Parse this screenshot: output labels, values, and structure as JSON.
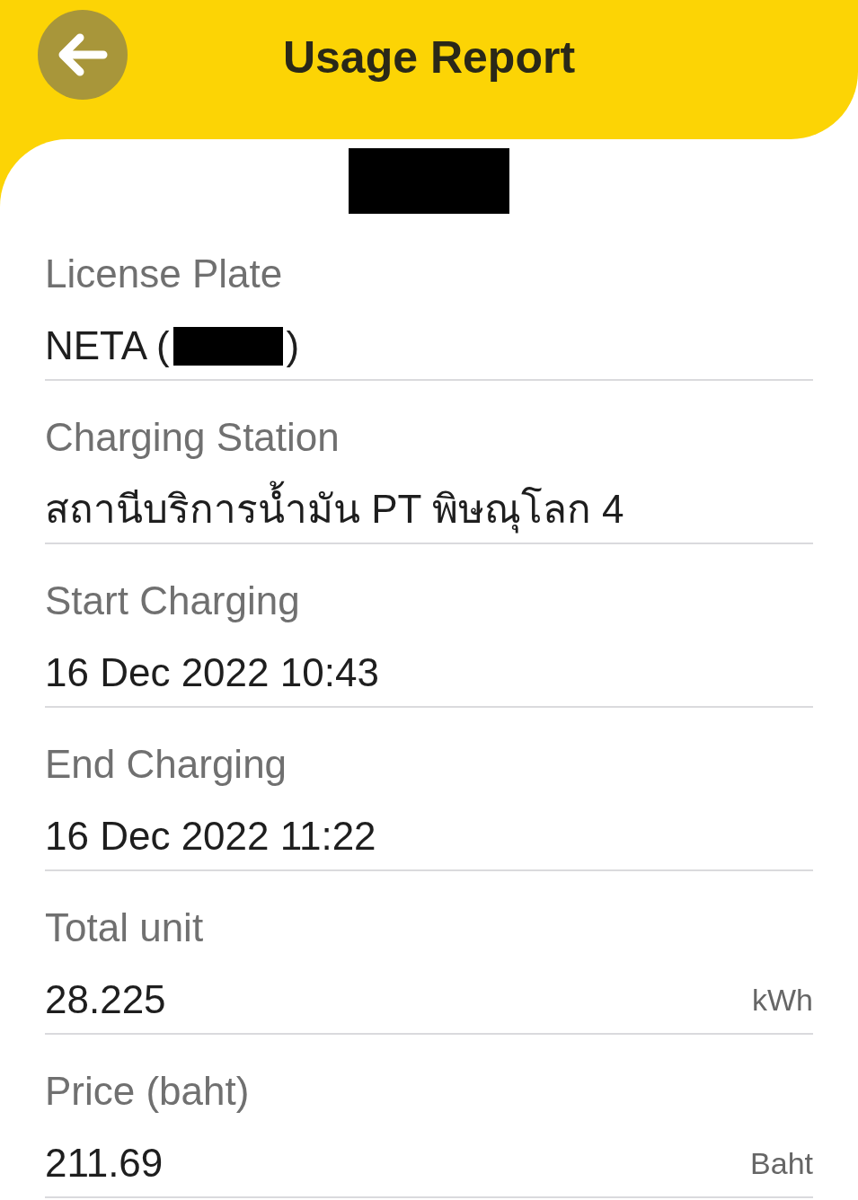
{
  "header": {
    "title": "Usage Report"
  },
  "banner": {
    "redacted": true
  },
  "fields": [
    {
      "label": "License Plate",
      "value": "NETA (",
      "value_suffix": ")",
      "redacted": true
    },
    {
      "label": "Charging Station",
      "value": "สถานีบริการน้ำมัน PT พิษณุโลก 4"
    },
    {
      "label": "Start Charging",
      "value": "16 Dec 2022 10:43"
    },
    {
      "label": "End Charging",
      "value": "16 Dec 2022 11:22"
    },
    {
      "label": "Total unit",
      "value": "28.225",
      "unit": "kWh"
    },
    {
      "label": "Price (baht)",
      "value": "211.69",
      "unit": "Baht"
    }
  ]
}
